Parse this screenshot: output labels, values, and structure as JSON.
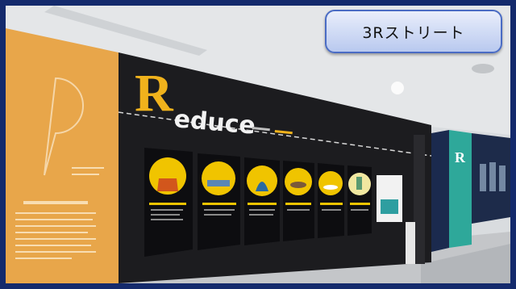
{
  "caption": {
    "label": "3Rストリート"
  },
  "wall": {
    "logo_initial": "R",
    "logo_rest": "educe",
    "far_wall_initial": "R"
  },
  "colors": {
    "frame": "#142a6c",
    "orange_panel": "#e8a64a",
    "black_wall": "#1c1c1f",
    "teal_panel": "#2ea89a",
    "logo_yellow": "#f0b21c",
    "caption_fill": "#c8d5f4"
  },
  "posters": [
    {
      "accent": "#f0c400",
      "icon": "bag-icon"
    },
    {
      "accent": "#f0c400",
      "icon": "tray-icon"
    },
    {
      "accent": "#f0c400",
      "icon": "person-icon"
    },
    {
      "accent": "#f0c400",
      "icon": "fish-icon"
    },
    {
      "accent": "#f0c400",
      "icon": "dish-icon"
    },
    {
      "accent": "#f0c400",
      "icon": "bottle-icon"
    }
  ]
}
